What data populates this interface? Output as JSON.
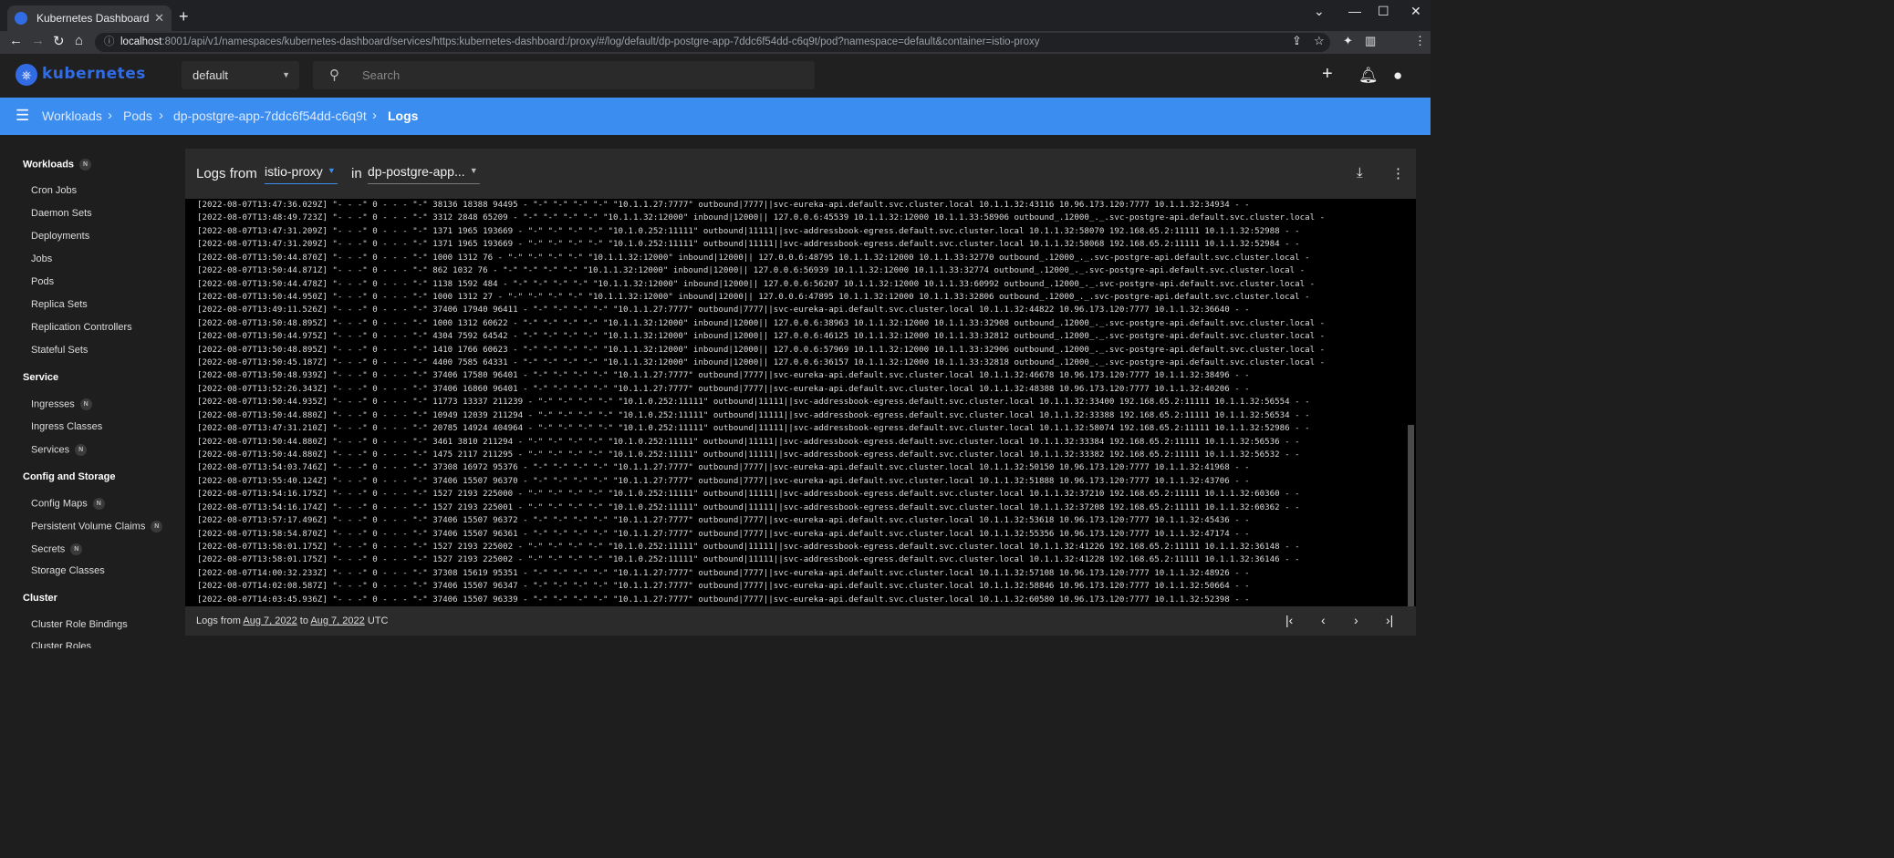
{
  "browser": {
    "tab_title": "Kubernetes Dashboard",
    "tab_close": "✕",
    "new_tab": "+",
    "url_host": "localhost",
    "url_rest": ":8001/api/v1/namespaces/kubernetes-dashboard/services/https:kubernetes-dashboard:/proxy/#/log/default/dp-postgre-app-7ddc6f54dd-c6q9t/pod?namespace=default&container=istio-proxy"
  },
  "header": {
    "brand": "kubernetes",
    "namespace": "default",
    "search_placeholder": "Search"
  },
  "breadcrumb": [
    "Workloads",
    "Pods",
    "dp-postgre-app-7ddc6f54dd-c6q9t",
    "Logs"
  ],
  "sidebar": {
    "sections": [
      {
        "title": "Workloads",
        "badge": "N",
        "items": [
          {
            "label": "Cron Jobs"
          },
          {
            "label": "Daemon Sets"
          },
          {
            "label": "Deployments"
          },
          {
            "label": "Jobs"
          },
          {
            "label": "Pods"
          },
          {
            "label": "Replica Sets"
          },
          {
            "label": "Replication Controllers"
          },
          {
            "label": "Stateful Sets"
          }
        ]
      },
      {
        "title": "Service",
        "items": [
          {
            "label": "Ingresses",
            "badge": "N"
          },
          {
            "label": "Ingress Classes"
          },
          {
            "label": "Services",
            "badge": "N"
          }
        ]
      },
      {
        "title": "Config and Storage",
        "items": [
          {
            "label": "Config Maps",
            "badge": "N"
          },
          {
            "label": "Persistent Volume Claims",
            "badge": "N"
          },
          {
            "label": "Secrets",
            "badge": "N"
          },
          {
            "label": "Storage Classes"
          }
        ]
      },
      {
        "title": "Cluster",
        "items": [
          {
            "label": "Cluster Role Bindings"
          },
          {
            "label": "Cluster Roles"
          }
        ]
      }
    ]
  },
  "logs": {
    "title": "Logs from",
    "container": "istio-proxy",
    "in_label": "in",
    "pod": "dp-postgre-app...",
    "lines": [
      "[2022-08-07T13:47:36.029Z] \"- - -\" 0 - - - \"-\" 38136 18388 94495 - \"-\" \"-\" \"-\" \"-\" \"10.1.1.27:7777\" outbound|7777||svc-eureka-api.default.svc.cluster.local 10.1.1.32:43116 10.96.173.120:7777 10.1.1.32:34934 - -",
      "[2022-08-07T13:48:49.723Z] \"- - -\" 0 - - - \"-\" 3312 2848 65209 - \"-\" \"-\" \"-\" \"-\" \"10.1.1.32:12000\" inbound|12000|| 127.0.0.6:45539 10.1.1.32:12000 10.1.1.33:58906 outbound_.12000_._.svc-postgre-api.default.svc.cluster.local -",
      "[2022-08-07T13:47:31.209Z] \"- - -\" 0 - - - \"-\" 1371 1965 193669 - \"-\" \"-\" \"-\" \"-\" \"10.1.0.252:11111\" outbound|11111||svc-addressbook-egress.default.svc.cluster.local 10.1.1.32:58070 192.168.65.2:11111 10.1.1.32:52988 - -",
      "[2022-08-07T13:47:31.209Z] \"- - -\" 0 - - - \"-\" 1371 1965 193669 - \"-\" \"-\" \"-\" \"-\" \"10.1.0.252:11111\" outbound|11111||svc-addressbook-egress.default.svc.cluster.local 10.1.1.32:58068 192.168.65.2:11111 10.1.1.32:52984 - -",
      "[2022-08-07T13:50:44.870Z] \"- - -\" 0 - - - \"-\" 1000 1312 76 - \"-\" \"-\" \"-\" \"-\" \"10.1.1.32:12000\" inbound|12000|| 127.0.0.6:48795 10.1.1.32:12000 10.1.1.33:32770 outbound_.12000_._.svc-postgre-api.default.svc.cluster.local -",
      "[2022-08-07T13:50:44.871Z] \"- - -\" 0 - - - \"-\" 862 1032 76 - \"-\" \"-\" \"-\" \"-\" \"10.1.1.32:12000\" inbound|12000|| 127.0.0.6:56939 10.1.1.32:12000 10.1.1.33:32774 outbound_.12000_._.svc-postgre-api.default.svc.cluster.local -",
      "[2022-08-07T13:50:44.478Z] \"- - -\" 0 - - - \"-\" 1138 1592 484 - \"-\" \"-\" \"-\" \"-\" \"10.1.1.32:12000\" inbound|12000|| 127.0.0.6:56207 10.1.1.32:12000 10.1.1.33:60992 outbound_.12000_._.svc-postgre-api.default.svc.cluster.local -",
      "[2022-08-07T13:50:44.950Z] \"- - -\" 0 - - - \"-\" 1000 1312 27 - \"-\" \"-\" \"-\" \"-\" \"10.1.1.32:12000\" inbound|12000|| 127.0.0.6:47895 10.1.1.32:12000 10.1.1.33:32806 outbound_.12000_._.svc-postgre-api.default.svc.cluster.local -",
      "[2022-08-07T13:49:11.526Z] \"- - -\" 0 - - - \"-\" 37406 17940 96411 - \"-\" \"-\" \"-\" \"-\" \"10.1.1.27:7777\" outbound|7777||svc-eureka-api.default.svc.cluster.local 10.1.1.32:44822 10.96.173.120:7777 10.1.1.32:36640 - -",
      "[2022-08-07T13:50:48.895Z] \"- - -\" 0 - - - \"-\" 1000 1312 60622 - \"-\" \"-\" \"-\" \"-\" \"10.1.1.32:12000\" inbound|12000|| 127.0.0.6:38963 10.1.1.32:12000 10.1.1.33:32908 outbound_.12000_._.svc-postgre-api.default.svc.cluster.local -",
      "[2022-08-07T13:50:44.975Z] \"- - -\" 0 - - - \"-\" 4304 7592 64542 - \"-\" \"-\" \"-\" \"-\" \"10.1.1.32:12000\" inbound|12000|| 127.0.0.6:46125 10.1.1.32:12000 10.1.1.33:32812 outbound_.12000_._.svc-postgre-api.default.svc.cluster.local -",
      "[2022-08-07T13:50:48.895Z] \"- - -\" 0 - - - \"-\" 1410 1766 60623 - \"-\" \"-\" \"-\" \"-\" \"10.1.1.32:12000\" inbound|12000|| 127.0.0.6:57969 10.1.1.32:12000 10.1.1.33:32906 outbound_.12000_._.svc-postgre-api.default.svc.cluster.local -",
      "[2022-08-07T13:50:45.187Z] \"- - -\" 0 - - - \"-\" 4400 7585 64331 - \"-\" \"-\" \"-\" \"-\" \"10.1.1.32:12000\" inbound|12000|| 127.0.0.6:36157 10.1.1.32:12000 10.1.1.33:32818 outbound_.12000_._.svc-postgre-api.default.svc.cluster.local -",
      "[2022-08-07T13:50:48.939Z] \"- - -\" 0 - - - \"-\" 37406 17580 96401 - \"-\" \"-\" \"-\" \"-\" \"10.1.1.27:7777\" outbound|7777||svc-eureka-api.default.svc.cluster.local 10.1.1.32:46678 10.96.173.120:7777 10.1.1.32:38496 - -",
      "[2022-08-07T13:52:26.343Z] \"- - -\" 0 - - - \"-\" 37406 16860 96401 - \"-\" \"-\" \"-\" \"-\" \"10.1.1.27:7777\" outbound|7777||svc-eureka-api.default.svc.cluster.local 10.1.1.32:48388 10.96.173.120:7777 10.1.1.32:40206 - -",
      "[2022-08-07T13:50:44.935Z] \"- - -\" 0 - - - \"-\" 11773 13337 211239 - \"-\" \"-\" \"-\" \"-\" \"10.1.0.252:11111\" outbound|11111||svc-addressbook-egress.default.svc.cluster.local 10.1.1.32:33400 192.168.65.2:11111 10.1.1.32:56554 - -",
      "[2022-08-07T13:50:44.880Z] \"- - -\" 0 - - - \"-\" 10949 12039 211294 - \"-\" \"-\" \"-\" \"-\" \"10.1.0.252:11111\" outbound|11111||svc-addressbook-egress.default.svc.cluster.local 10.1.1.32:33388 192.168.65.2:11111 10.1.1.32:56534 - -",
      "[2022-08-07T13:47:31.210Z] \"- - -\" 0 - - - \"-\" 20785 14924 404964 - \"-\" \"-\" \"-\" \"-\" \"10.1.0.252:11111\" outbound|11111||svc-addressbook-egress.default.svc.cluster.local 10.1.1.32:58074 192.168.65.2:11111 10.1.1.32:52986 - -",
      "[2022-08-07T13:50:44.880Z] \"- - -\" 0 - - - \"-\" 3461 3810 211294 - \"-\" \"-\" \"-\" \"-\" \"10.1.0.252:11111\" outbound|11111||svc-addressbook-egress.default.svc.cluster.local 10.1.1.32:33384 192.168.65.2:11111 10.1.1.32:56536 - -",
      "[2022-08-07T13:50:44.880Z] \"- - -\" 0 - - - \"-\" 1475 2117 211295 - \"-\" \"-\" \"-\" \"-\" \"10.1.0.252:11111\" outbound|11111||svc-addressbook-egress.default.svc.cluster.local 10.1.1.32:33382 192.168.65.2:11111 10.1.1.32:56532 - -",
      "[2022-08-07T13:54:03.746Z] \"- - -\" 0 - - - \"-\" 37308 16972 95376 - \"-\" \"-\" \"-\" \"-\" \"10.1.1.27:7777\" outbound|7777||svc-eureka-api.default.svc.cluster.local 10.1.1.32:50150 10.96.173.120:7777 10.1.1.32:41968 - -",
      "[2022-08-07T13:55:40.124Z] \"- - -\" 0 - - - \"-\" 37406 15507 96370 - \"-\" \"-\" \"-\" \"-\" \"10.1.1.27:7777\" outbound|7777||svc-eureka-api.default.svc.cluster.local 10.1.1.32:51888 10.96.173.120:7777 10.1.1.32:43706 - -",
      "[2022-08-07T13:54:16.175Z] \"- - -\" 0 - - - \"-\" 1527 2193 225000 - \"-\" \"-\" \"-\" \"-\" \"10.1.0.252:11111\" outbound|11111||svc-addressbook-egress.default.svc.cluster.local 10.1.1.32:37210 192.168.65.2:11111 10.1.1.32:60360 - -",
      "[2022-08-07T13:54:16.174Z] \"- - -\" 0 - - - \"-\" 1527 2193 225001 - \"-\" \"-\" \"-\" \"-\" \"10.1.0.252:11111\" outbound|11111||svc-addressbook-egress.default.svc.cluster.local 10.1.1.32:37208 192.168.65.2:11111 10.1.1.32:60362 - -",
      "[2022-08-07T13:57:17.496Z] \"- - -\" 0 - - - \"-\" 37406 15507 96372 - \"-\" \"-\" \"-\" \"-\" \"10.1.1.27:7777\" outbound|7777||svc-eureka-api.default.svc.cluster.local 10.1.1.32:53618 10.96.173.120:7777 10.1.1.32:45436 - -",
      "[2022-08-07T13:58:54.870Z] \"- - -\" 0 - - - \"-\" 37406 15507 96361 - \"-\" \"-\" \"-\" \"-\" \"10.1.1.27:7777\" outbound|7777||svc-eureka-api.default.svc.cluster.local 10.1.1.32:55356 10.96.173.120:7777 10.1.1.32:47174 - -",
      "[2022-08-07T13:58:01.175Z] \"- - -\" 0 - - - \"-\" 1527 2193 225002 - \"-\" \"-\" \"-\" \"-\" \"10.1.0.252:11111\" outbound|11111||svc-addressbook-egress.default.svc.cluster.local 10.1.1.32:41226 192.168.65.2:11111 10.1.1.32:36148 - -",
      "[2022-08-07T13:58:01.175Z] \"- - -\" 0 - - - \"-\" 1527 2193 225002 - \"-\" \"-\" \"-\" \"-\" \"10.1.0.252:11111\" outbound|11111||svc-addressbook-egress.default.svc.cluster.local 10.1.1.32:41228 192.168.65.2:11111 10.1.1.32:36146 - -",
      "[2022-08-07T14:00:32.233Z] \"- - -\" 0 - - - \"-\" 37308 15619 95351 - \"-\" \"-\" \"-\" \"-\" \"10.1.1.27:7777\" outbound|7777||svc-eureka-api.default.svc.cluster.local 10.1.1.32:57108 10.96.173.120:7777 10.1.1.32:48926 - -",
      "[2022-08-07T14:02:08.587Z] \"- - -\" 0 - - - \"-\" 37406 15507 96347 - \"-\" \"-\" \"-\" \"-\" \"10.1.1.27:7777\" outbound|7777||svc-eureka-api.default.svc.cluster.local 10.1.1.32:58846 10.96.173.120:7777 10.1.1.32:50664 - -",
      "[2022-08-07T14:03:45.936Z] \"- - -\" 0 - - - \"-\" 37406 15507 96339 - \"-\" \"-\" \"-\" \"-\" \"10.1.1.27:7777\" outbound|7777||svc-eureka-api.default.svc.cluster.local 10.1.1.32:60580 10.96.173.120:7777 10.1.1.32:52398 - -"
    ],
    "footer": {
      "prefix": "Logs from",
      "from": "Aug 7, 2022",
      "to_label": "to",
      "to": "Aug 7, 2022",
      "tz": "UTC"
    }
  },
  "colors": {
    "accent": "#3b8ef0",
    "brand": "#326ce5"
  }
}
